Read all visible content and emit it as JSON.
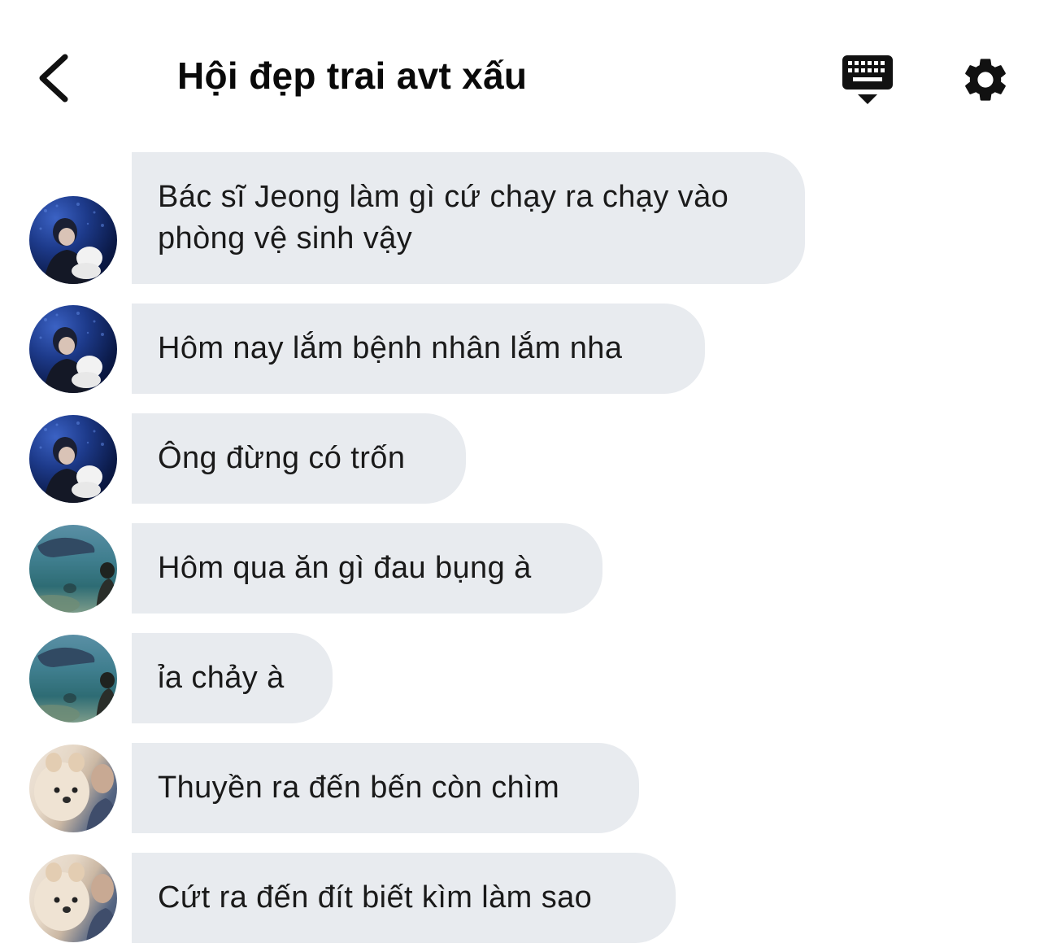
{
  "header": {
    "title": "Hội đẹp trai avt xấu",
    "back_icon": "chevron-left-icon",
    "keyboard_icon": "keyboard-icon",
    "settings_icon": "gear-icon"
  },
  "messages": [
    {
      "text": "Bác sĩ Jeong làm gì cứ chạy ra chạy vào phòng vệ sinh vậy",
      "avatar": "night-aquarium-photo"
    },
    {
      "text": "Hôm nay lắm bệnh nhân lắm nha",
      "avatar": "night-aquarium-photo"
    },
    {
      "text": "Ông đừng có trốn",
      "avatar": "night-aquarium-photo"
    },
    {
      "text": "Hôm qua ăn gì đau bụng à",
      "avatar": "aquarium-photo"
    },
    {
      "text": "ỉa chảy à",
      "avatar": "aquarium-photo"
    },
    {
      "text": "Thuyền ra đến bến còn chìm",
      "avatar": "dog-photo"
    },
    {
      "text": "Cứt ra đến đít biết kìm làm sao",
      "avatar": "dog-photo"
    }
  ],
  "colors": {
    "bubble_bg": "#e8ebef",
    "text": "#1a1a1a",
    "icon": "#111111"
  }
}
